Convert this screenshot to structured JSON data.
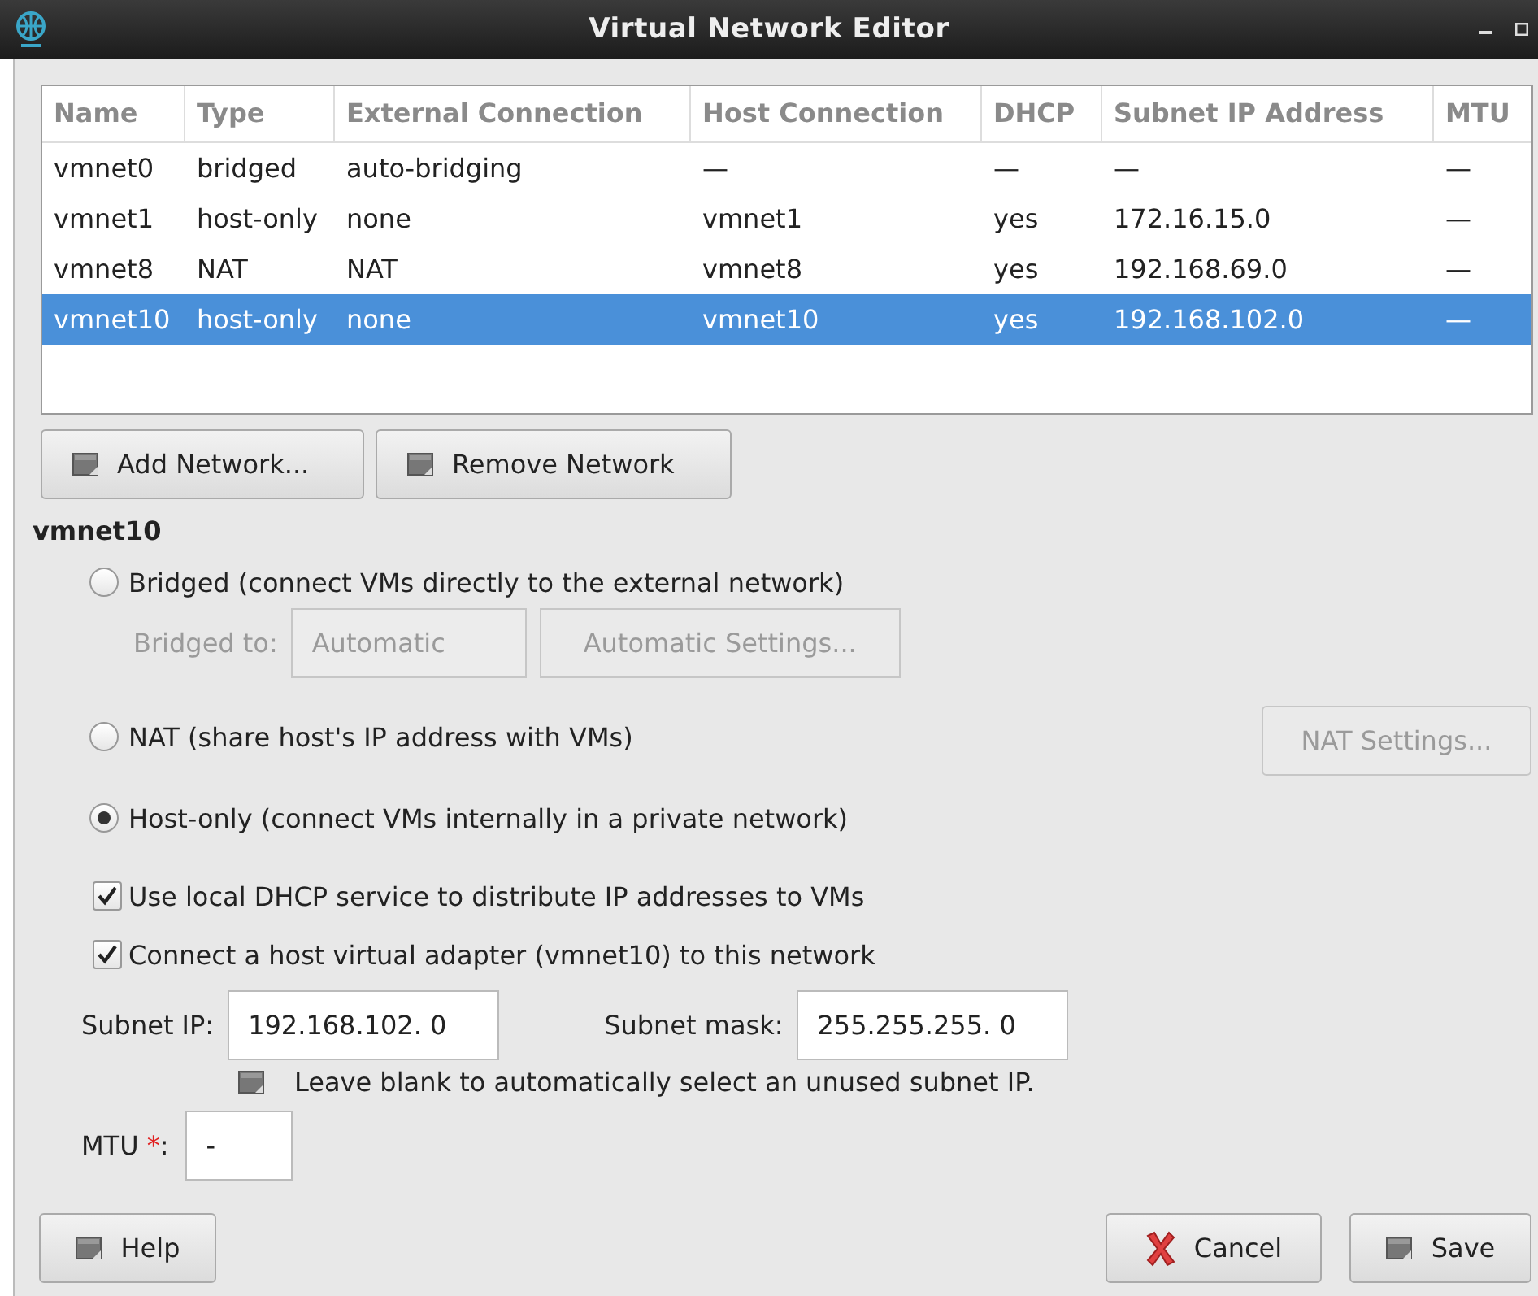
{
  "window": {
    "title": "Virtual Network Editor"
  },
  "table": {
    "columns": [
      "Name",
      "Type",
      "External Connection",
      "Host Connection",
      "DHCP",
      "Subnet IP Address",
      "MTU"
    ],
    "rows": [
      {
        "cells": [
          "vmnet0",
          "bridged",
          "auto-bridging",
          "—",
          "—",
          "—",
          "—"
        ],
        "selected": false
      },
      {
        "cells": [
          "vmnet1",
          "host-only",
          "none",
          "vmnet1",
          "yes",
          "172.16.15.0",
          "—"
        ],
        "selected": false
      },
      {
        "cells": [
          "vmnet8",
          "NAT",
          "NAT",
          "vmnet8",
          "yes",
          "192.168.69.0",
          "—"
        ],
        "selected": false
      },
      {
        "cells": [
          "vmnet10",
          "host-only",
          "none",
          "vmnet10",
          "yes",
          "192.168.102.0",
          "—"
        ],
        "selected": true
      }
    ]
  },
  "network_buttons": [
    {
      "label": "Add Network..."
    },
    {
      "label": "Remove Network"
    }
  ],
  "section_title": "vmnet10",
  "connection_options": [
    {
      "label": "Bridged (connect VMs directly to the external network)",
      "selected": false
    },
    {
      "label": "NAT (share host's IP address with VMs)",
      "selected": false
    },
    {
      "label": "Host-only (connect VMs internally in a private network)",
      "selected": true
    }
  ],
  "bridged_to": {
    "label": "Bridged to:",
    "value": "Automatic",
    "disabled": true
  },
  "automatic_settings_button": {
    "label": "Automatic Settings...",
    "disabled": true
  },
  "nat_settings_button": {
    "label": "NAT Settings...",
    "disabled": true
  },
  "checkboxes": [
    {
      "label": "Use local DHCP service to distribute IP addresses to VMs",
      "checked": true
    },
    {
      "label": "Connect a host virtual adapter (vmnet10) to this network",
      "checked": true
    }
  ],
  "subnet_ip": {
    "label": "Subnet IP:",
    "value": "192.168.102.  0"
  },
  "subnet_mask": {
    "label": "Subnet mask:",
    "value": "255.255.255.  0"
  },
  "subnet_hint": "Leave blank to automatically select an unused subnet IP.",
  "mtu": {
    "label": "MTU",
    "required_mark": "*",
    "label_end": ":",
    "value": "-"
  },
  "footer_buttons": [
    {
      "kind": "help",
      "label": "Help"
    },
    {
      "kind": "cancel",
      "label": "Cancel"
    },
    {
      "kind": "save",
      "label": "Save"
    }
  ]
}
